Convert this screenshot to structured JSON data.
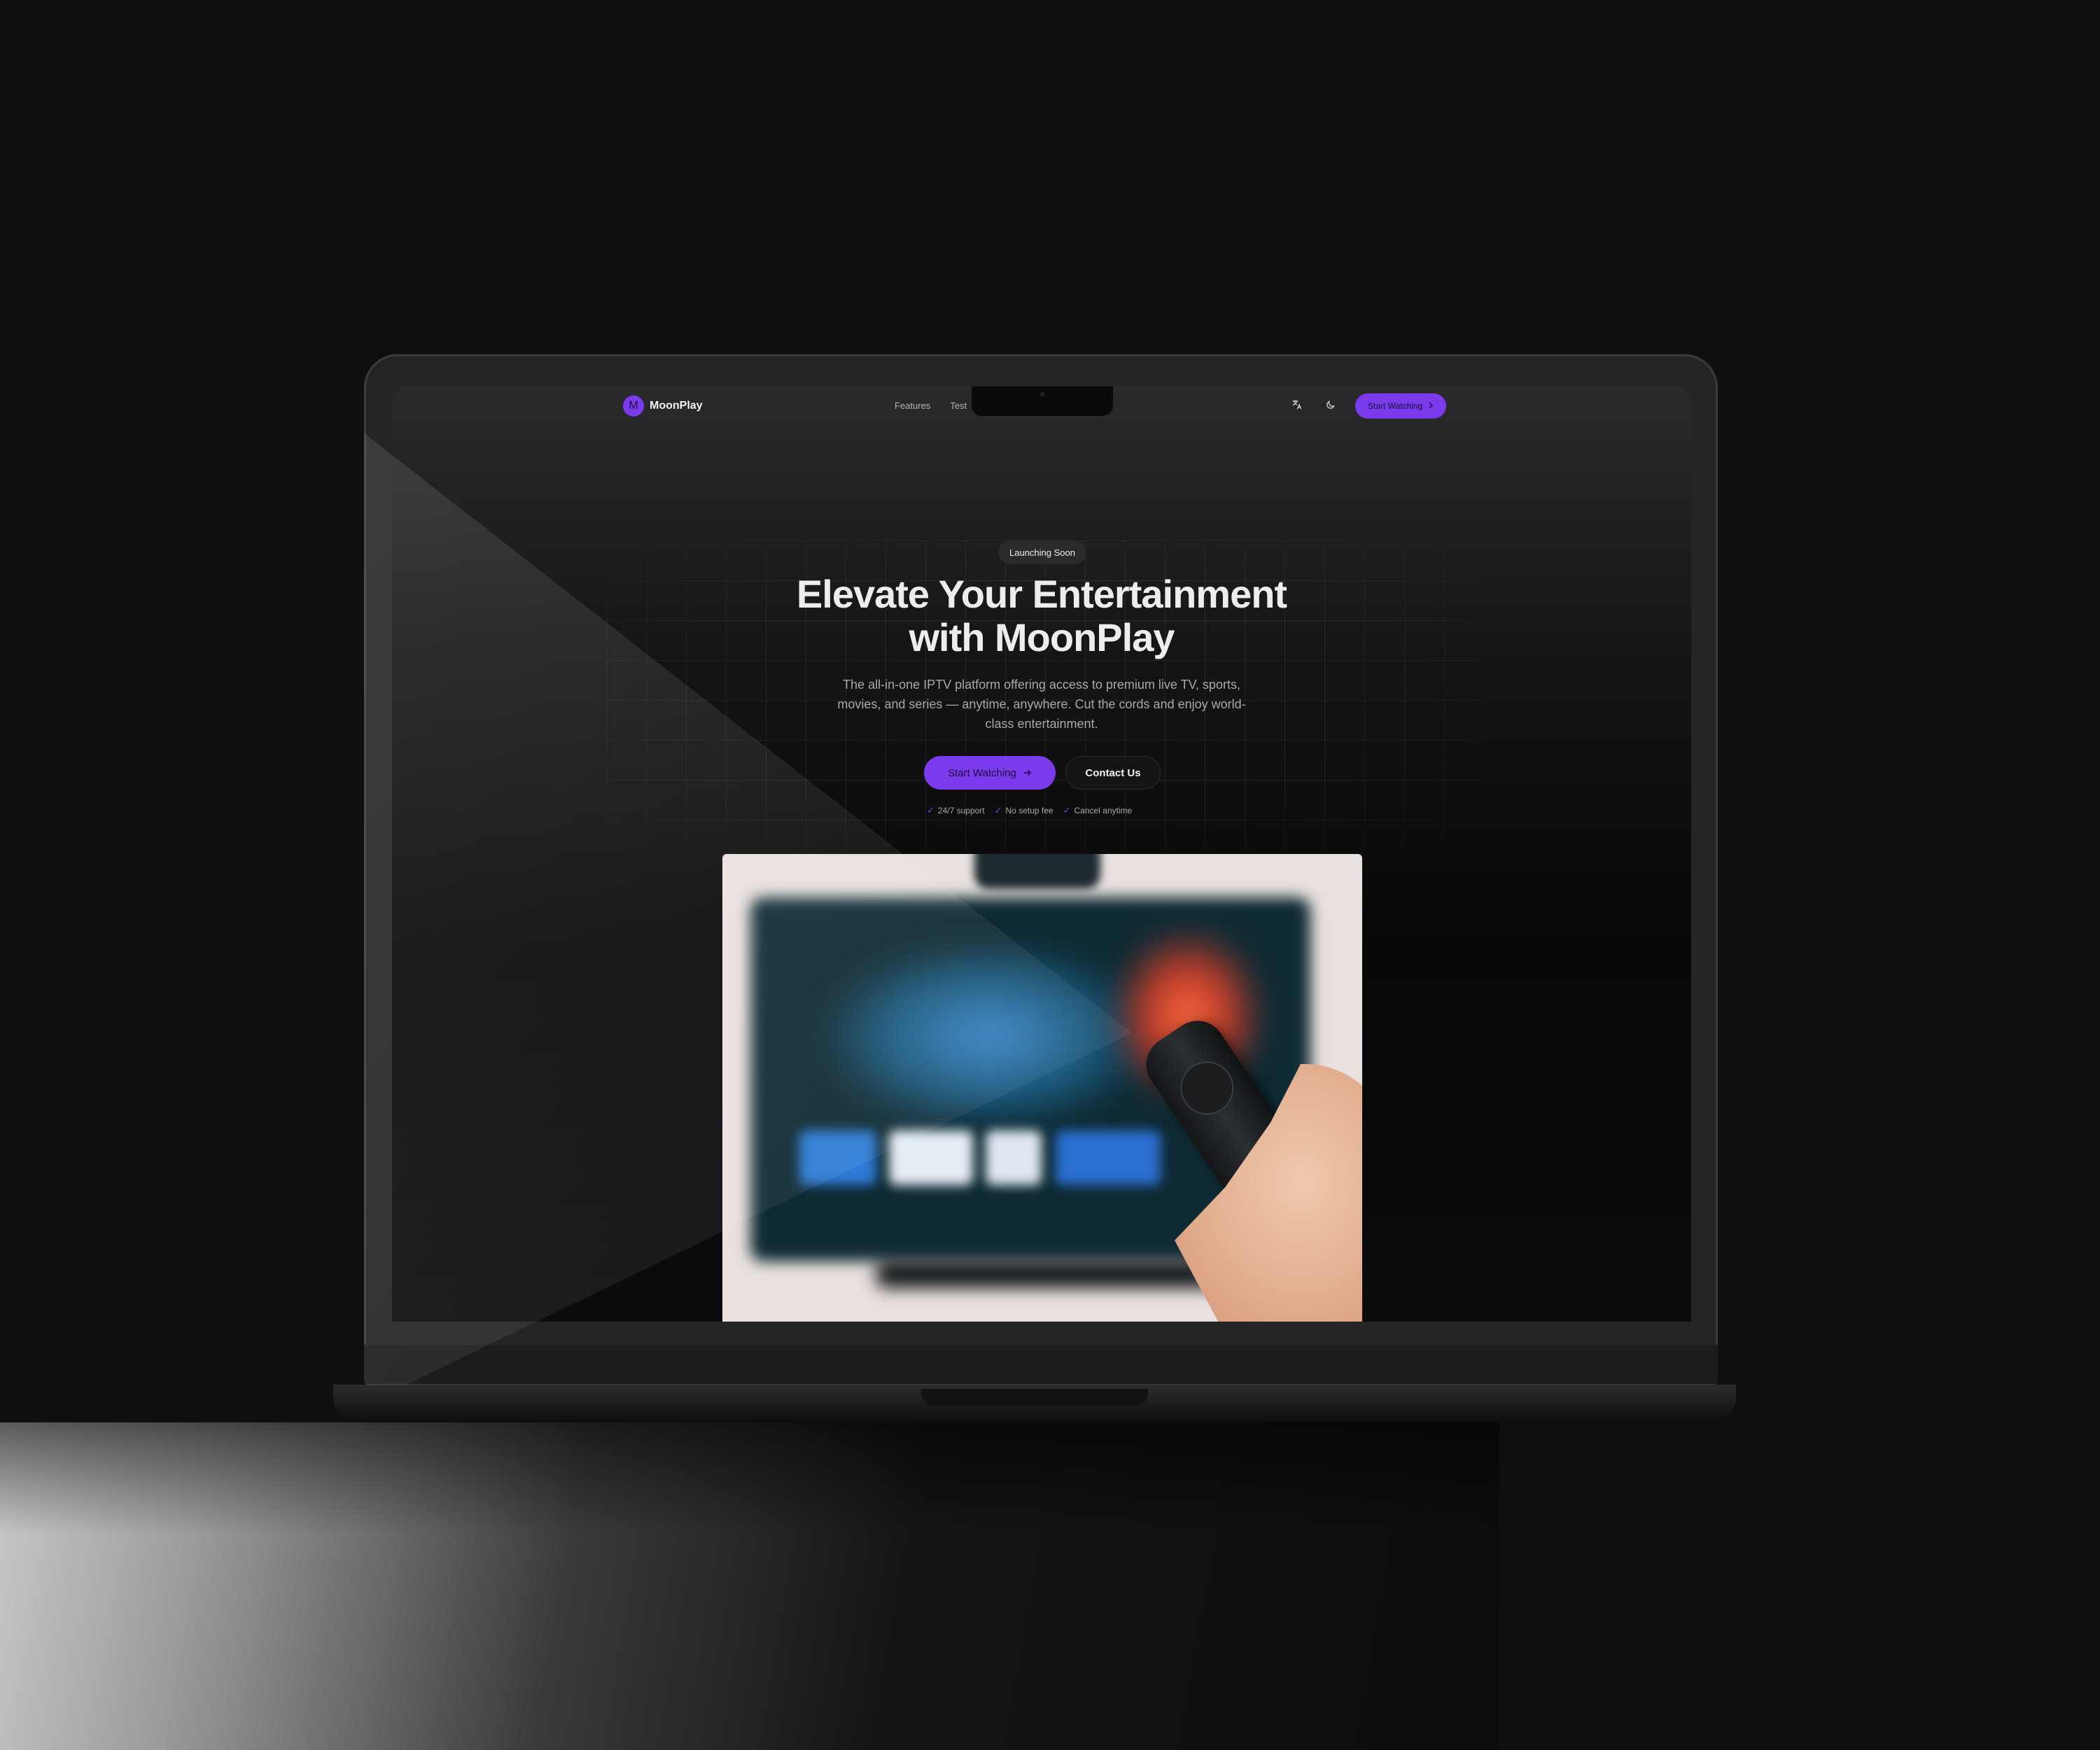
{
  "site": {
    "brand": {
      "logo_letter": "M",
      "name": "MoonPlay"
    },
    "nav": {
      "links": [
        "Features",
        "Test"
      ],
      "translate_icon": "translate-icon",
      "theme_icon": "moon-icon",
      "cta_label": "Start Watching",
      "cta_icon": "chevron-right-icon"
    },
    "hero": {
      "badge": "Launching Soon",
      "headline_line1": "Elevate Your Entertainment",
      "headline_line2": "with MoonPlay",
      "subtext": "The all-in-one IPTV platform offering access to premium live TV, sports, movies, and series — anytime, anywhere. Cut the cords and enjoy world-class entertainment.",
      "primary_cta": "Start Watching",
      "primary_cta_icon": "arrow-right-icon",
      "secondary_cta": "Contact Us",
      "perks": [
        "24/7 support",
        "No setup fee",
        "Cancel anytime"
      ],
      "perk_icon": "check-icon",
      "image_icon": "remote-tv-photo"
    },
    "colors": {
      "accent": "#7c3aed",
      "background": "#0f0f10",
      "text": "#ededed",
      "muted": "#a9a9ad"
    }
  }
}
